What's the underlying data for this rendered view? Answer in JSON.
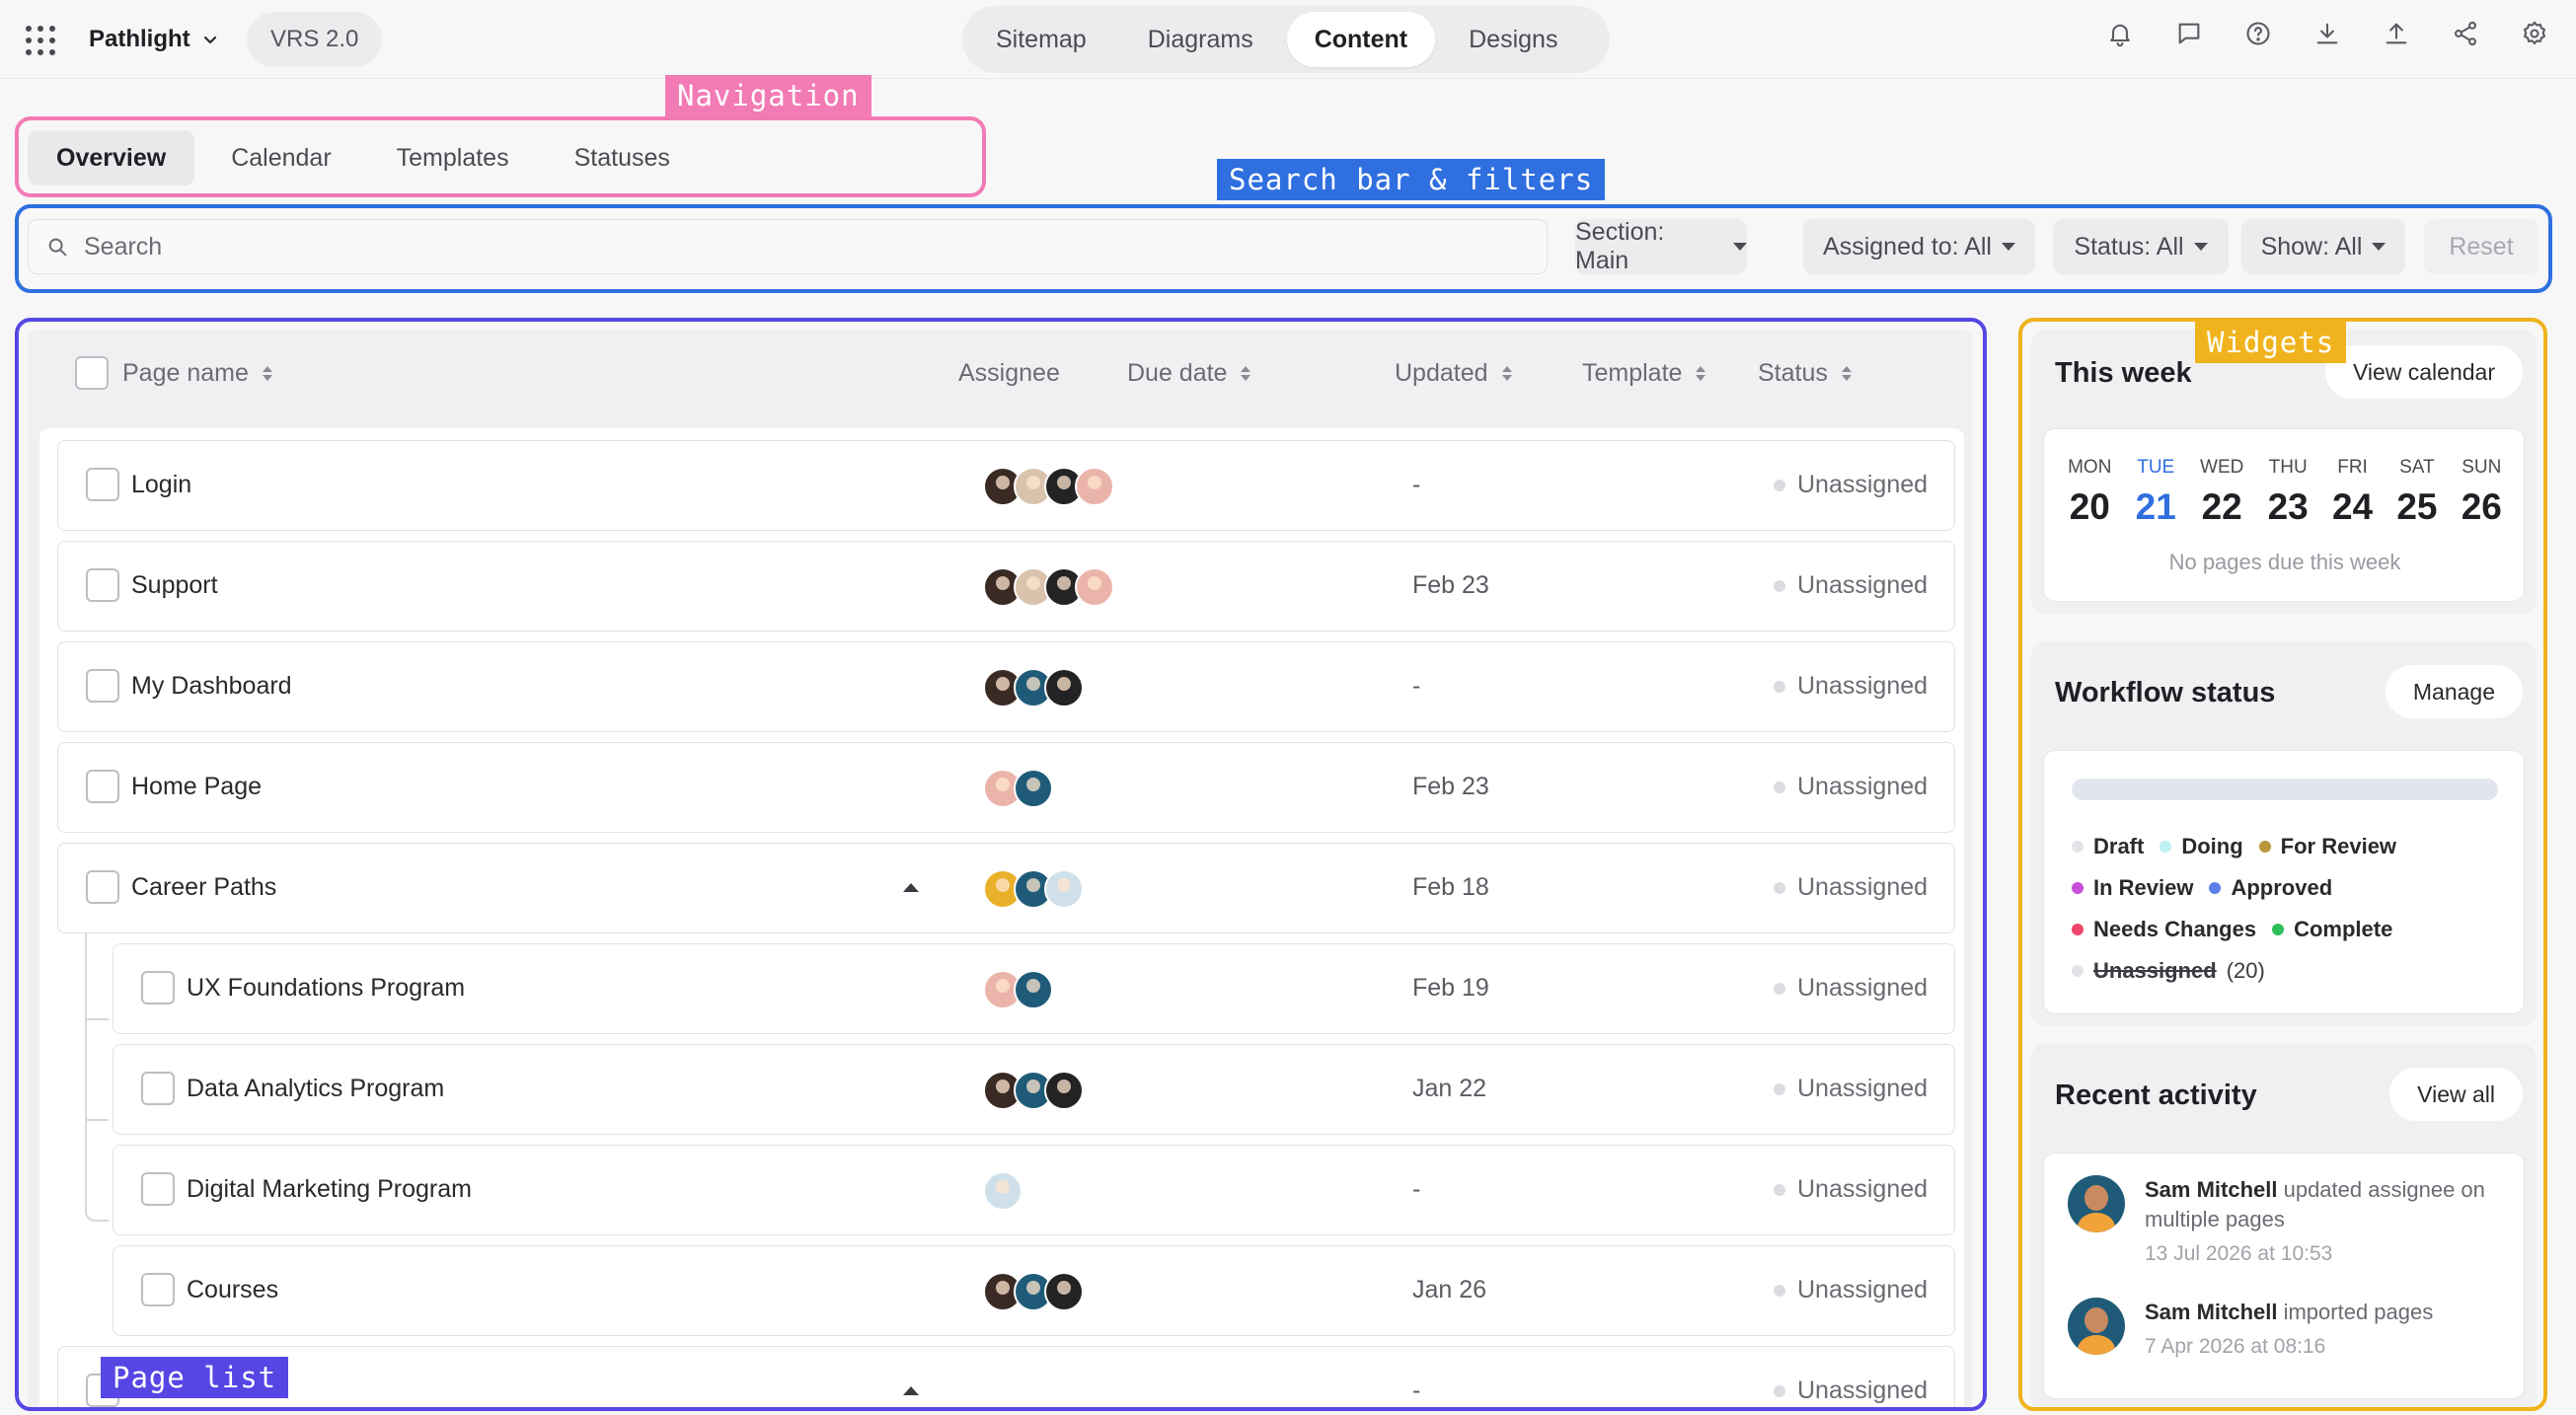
{
  "topbar": {
    "project": "Pathlight",
    "version": "VRS 2.0",
    "view_tabs": [
      "Sitemap",
      "Diagrams",
      "Content",
      "Designs"
    ],
    "active_view": "Content",
    "icons": [
      "bell-icon",
      "comment-icon",
      "help-icon",
      "download-icon",
      "upload-icon",
      "share-icon",
      "settings-icon"
    ]
  },
  "annotations": {
    "navigation": "Navigation",
    "search": "Search bar & filters",
    "page_list": "Page list",
    "widgets": "Widgets"
  },
  "nav": {
    "tabs": [
      "Overview",
      "Calendar",
      "Templates",
      "Statuses"
    ],
    "active": "Overview"
  },
  "search": {
    "placeholder": "Search"
  },
  "filters": {
    "section": "Section: Main",
    "assigned": "Assigned to: All",
    "status": "Status: All",
    "show": "Show: All",
    "reset": "Reset"
  },
  "table": {
    "columns": {
      "page_name": "Page name",
      "assignee": "Assignee",
      "due_date": "Due date",
      "updated": "Updated",
      "template": "Template",
      "status": "Status"
    },
    "rows": [
      {
        "name": "Login",
        "updated": "-",
        "status": "Unassigned"
      },
      {
        "name": "Support",
        "updated": "Feb 23",
        "status": "Unassigned"
      },
      {
        "name": "My Dashboard",
        "updated": "-",
        "status": "Unassigned"
      },
      {
        "name": "Home Page",
        "updated": "Feb 23",
        "status": "Unassigned"
      },
      {
        "name": "Career Paths",
        "updated": "Feb 18",
        "status": "Unassigned"
      },
      {
        "name": "UX Foundations Program",
        "updated": "Feb 19",
        "status": "Unassigned"
      },
      {
        "name": "Data Analytics Program",
        "updated": "Jan 22",
        "status": "Unassigned"
      },
      {
        "name": "Digital Marketing Program",
        "updated": "-",
        "status": "Unassigned"
      },
      {
        "name": "Courses",
        "updated": "Jan 26",
        "status": "Unassigned"
      },
      {
        "name": "",
        "updated": "-",
        "status": "Unassigned"
      }
    ]
  },
  "widgets": {
    "week": {
      "title": "This week",
      "button": "View calendar",
      "days": [
        {
          "label": "MON",
          "num": "20"
        },
        {
          "label": "TUE",
          "num": "21"
        },
        {
          "label": "WED",
          "num": "22"
        },
        {
          "label": "THU",
          "num": "23"
        },
        {
          "label": "FRI",
          "num": "24"
        },
        {
          "label": "SAT",
          "num": "25"
        },
        {
          "label": "SUN",
          "num": "26"
        }
      ],
      "today": "TUE",
      "empty": "No pages due this week"
    },
    "workflow": {
      "title": "Workflow status",
      "button": "Manage",
      "progress": 0,
      "legend": {
        "draft": "Draft",
        "doing": "Doing",
        "for_review": "For Review",
        "in_review": "In Review",
        "approved": "Approved",
        "needs_changes": "Needs Changes",
        "complete": "Complete",
        "unassigned": "Unassigned",
        "unassigned_count": "(20)"
      },
      "colors": {
        "draft": "#e3e3e7",
        "doing": "#bff0f3",
        "for_review": "#b8963a",
        "in_review": "#c84fd8",
        "approved": "#5b7fe6",
        "needs_changes": "#f0456b",
        "complete": "#2fbf5a",
        "unassigned": "#e3e3e7"
      }
    },
    "activity": {
      "title": "Recent activity",
      "button": "View all",
      "items": [
        {
          "user": "Sam Mitchell",
          "text": " updated assignee on multiple pages",
          "time": "13 Jul 2026 at 10:53"
        },
        {
          "user": "Sam Mitchell",
          "text": " imported pages",
          "time": "7 Apr 2026 at 08:16"
        }
      ]
    }
  }
}
